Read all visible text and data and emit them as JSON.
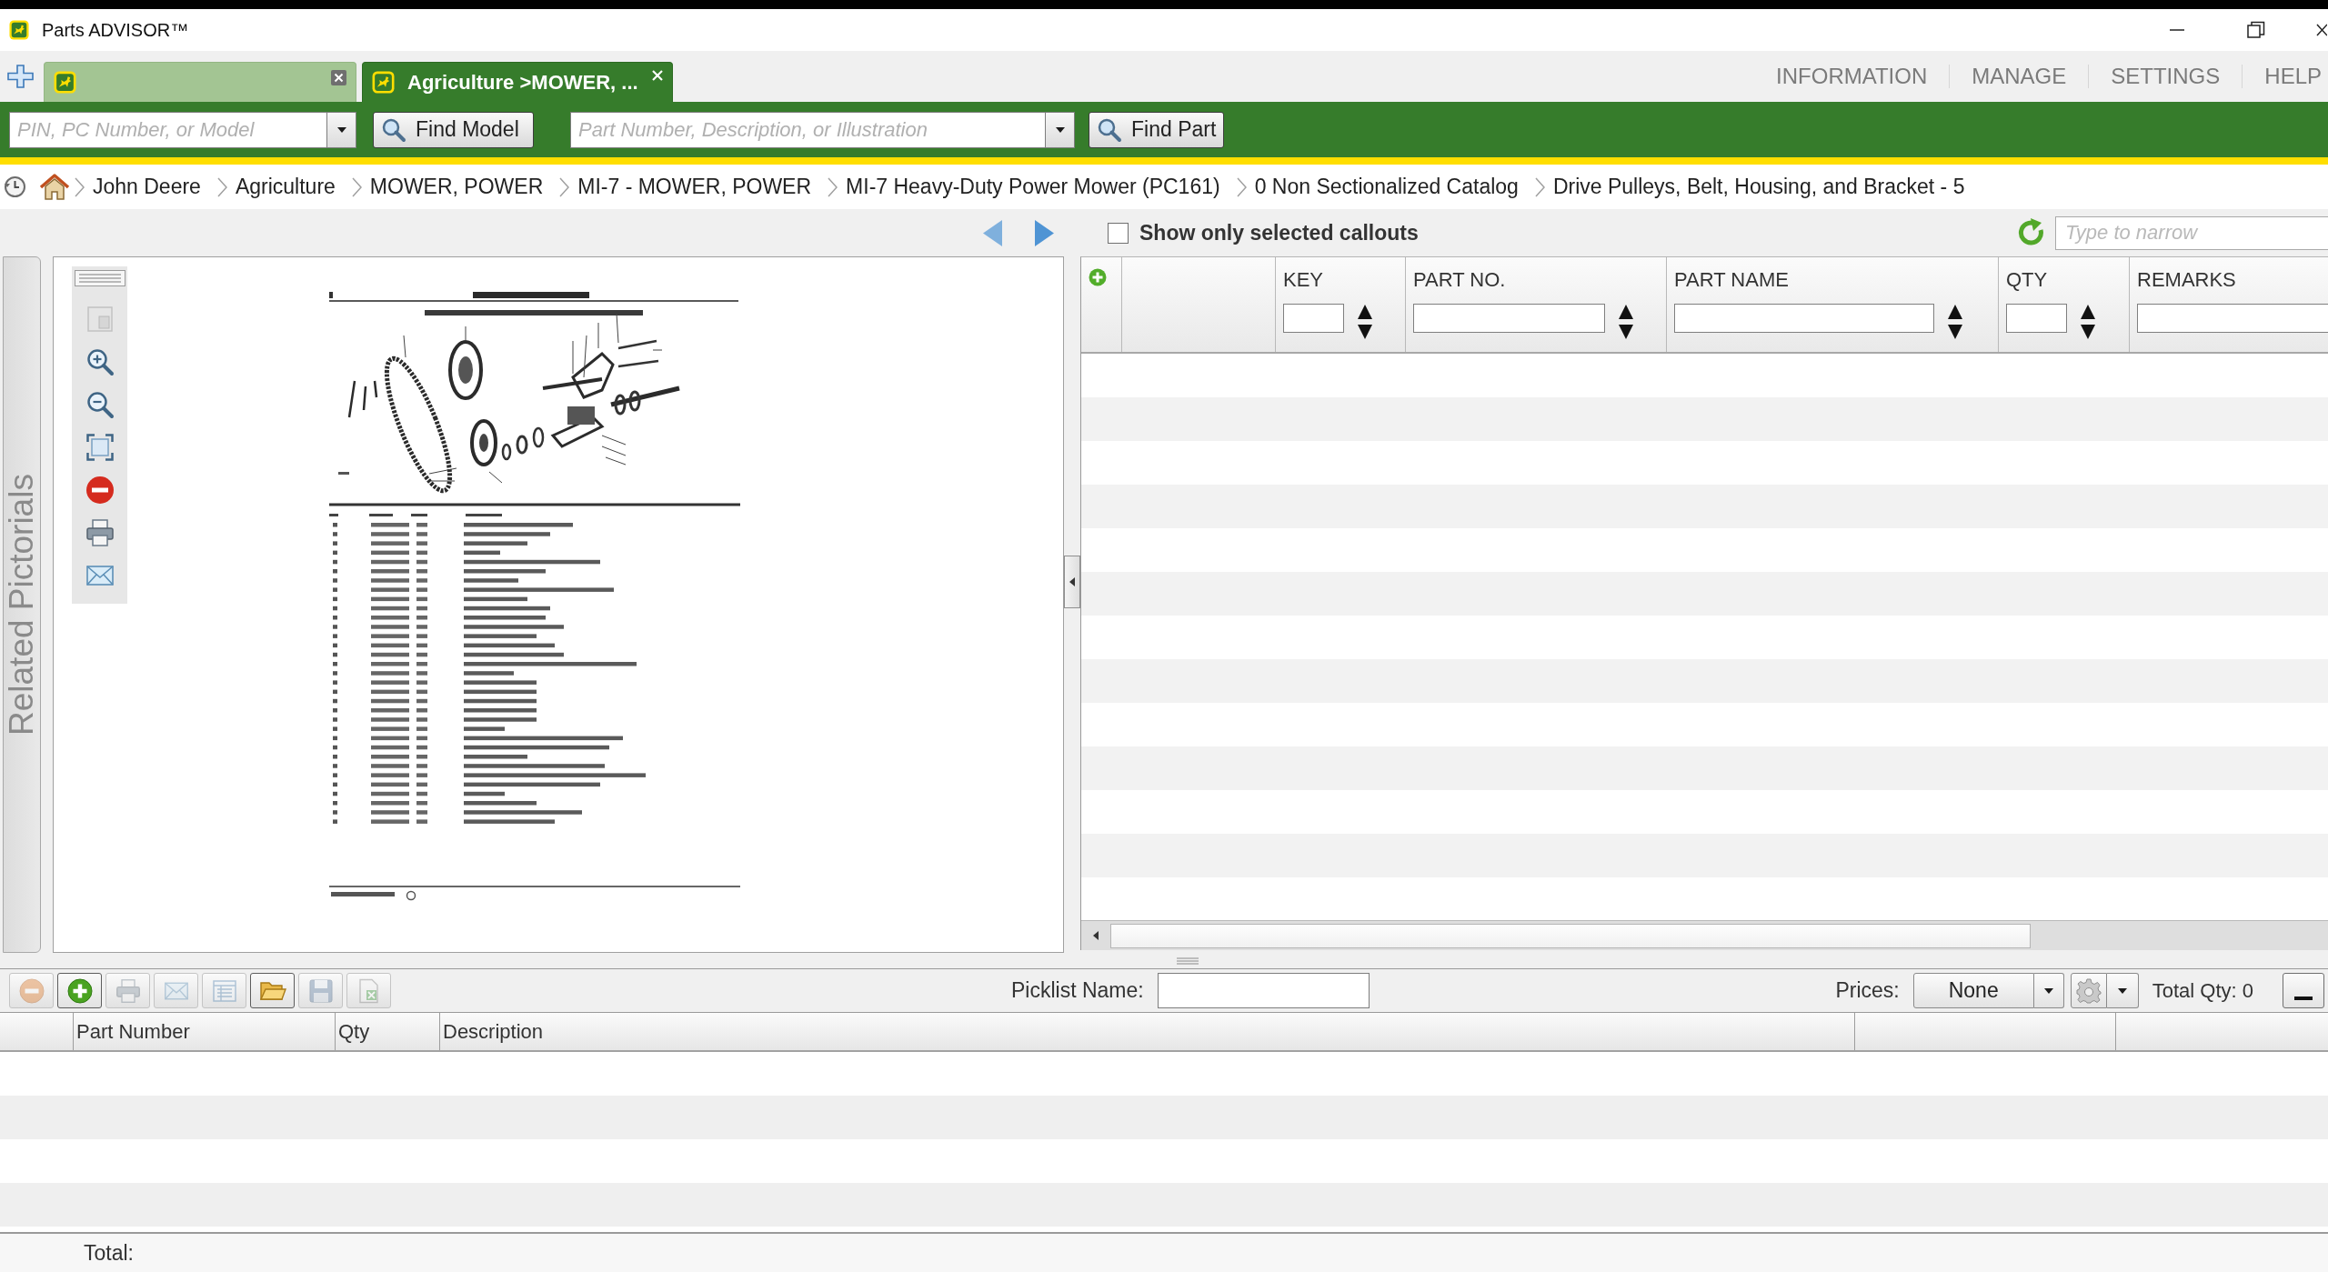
{
  "window": {
    "title": "Parts ADVISOR™"
  },
  "tabs": [
    {
      "selected": false
    },
    {
      "label": "Agriculture >MOWER, ...",
      "selected": true
    }
  ],
  "menu": [
    "INFORMATION",
    "MANAGE",
    "SETTINGS",
    "HELP"
  ],
  "model_search": {
    "placeholder": "PIN, PC Number, or Model",
    "button": "Find Model"
  },
  "part_search": {
    "placeholder": "Part Number, Description, or Illustration",
    "button": "Find Part"
  },
  "breadcrumb": [
    "John Deere",
    "Agriculture",
    "MOWER, POWER",
    "MI-7 - MOWER, POWER",
    "MI-7 Heavy-Duty Power Mower (PC161)",
    "0 Non Sectionalized Catalog",
    "Drive Pulleys, Belt, Housing, and Bracket - 5"
  ],
  "related_panel": {
    "label": "Related Pictorials"
  },
  "viewer_tools": [
    {
      "kind": "grip",
      "disabled": false
    },
    {
      "kind": "thumbnail",
      "disabled": true
    },
    {
      "kind": "zoom_in",
      "disabled": false
    },
    {
      "kind": "zoom_out",
      "disabled": false
    },
    {
      "kind": "fit",
      "disabled": false
    },
    {
      "kind": "remove",
      "disabled": false
    },
    {
      "kind": "print",
      "disabled": false
    },
    {
      "kind": "email",
      "disabled": false
    }
  ],
  "callouts": {
    "show_selected_only": {
      "label": "Show only selected callouts",
      "checked": false
    },
    "narrow": {
      "placeholder": "Type to narrow"
    },
    "columns": [
      "KEY",
      "PART NO.",
      "PART NAME",
      "QTY",
      "REMARKS"
    ]
  },
  "picklist": {
    "tools": [
      {
        "kind": "remove",
        "disabled": true
      },
      {
        "kind": "add",
        "disabled": false
      },
      {
        "kind": "print",
        "disabled": true
      },
      {
        "kind": "email",
        "disabled": true
      },
      {
        "kind": "list",
        "disabled": true
      },
      {
        "kind": "open",
        "disabled": false
      },
      {
        "kind": "save",
        "disabled": true
      },
      {
        "kind": "export",
        "disabled": true
      }
    ],
    "name_label": "Picklist Name:",
    "prices_label": "Prices:",
    "prices_value": "None",
    "total_qty": "Total Qty: 0",
    "columns": [
      "Part Number",
      "Qty",
      "Description"
    ],
    "total_label": "Total:"
  }
}
